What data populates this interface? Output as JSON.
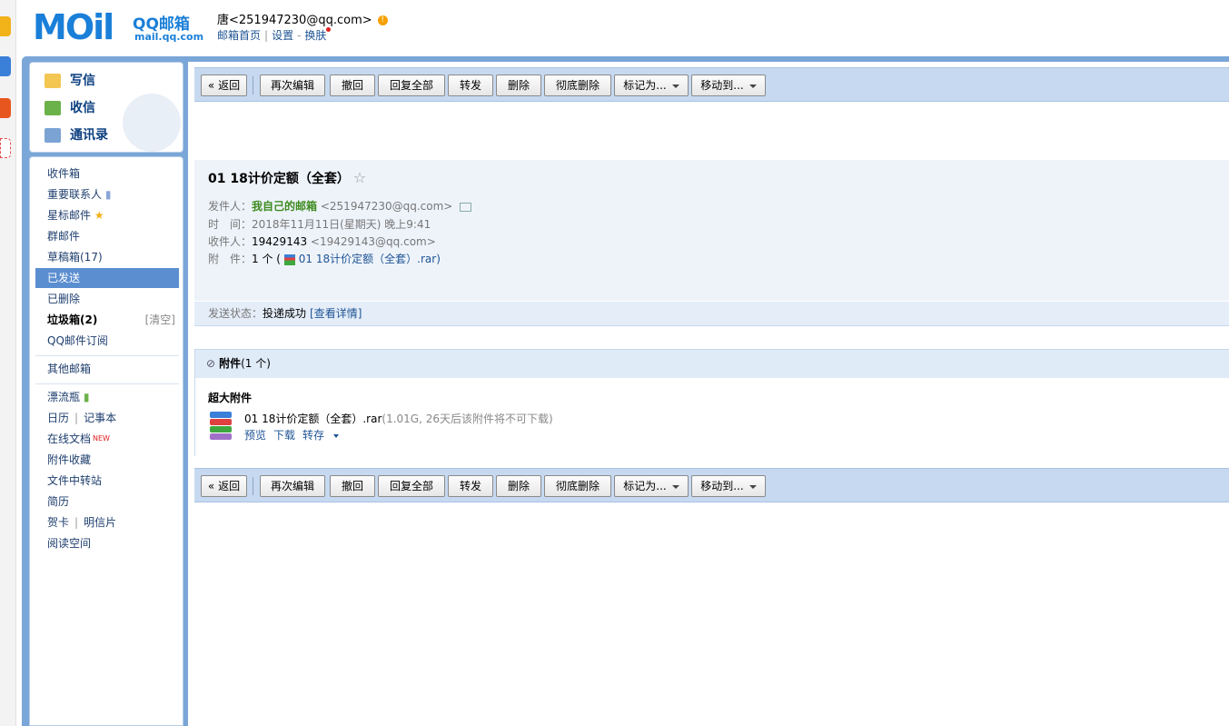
{
  "header": {
    "logo_word": "MOil",
    "logo_brand": "QQ邮箱",
    "logo_url": "mail.qq.com",
    "user": "唐<251947230@qq.com>",
    "links": [
      "邮箱首页",
      "设置",
      "换肤"
    ]
  },
  "compose": {
    "write": "写信",
    "receive": "收信",
    "contacts": "通讯录"
  },
  "folders": {
    "inbox": "收件箱",
    "important": "重要联系人",
    "starred": "星标邮件",
    "group": "群邮件",
    "drafts": "草稿箱(17)",
    "sent": "已发送",
    "deleted": "已删除",
    "junk": "垃圾箱(2)",
    "junk_clear": "[清空]",
    "subscriptions": "QQ邮件订阅",
    "other": "其他邮箱",
    "bottle": "漂流瓶",
    "calendar": "日历",
    "notes": "记事本",
    "docs": "在线文档",
    "docs_new": "NEW",
    "att_fav": "附件收藏",
    "transfer": "文件中转站",
    "resume": "简历",
    "greeting": "贺卡",
    "postcard": "明信片",
    "reading": "阅读空间"
  },
  "toolbar": {
    "back": "« 返回",
    "reedit": "再次编辑",
    "recall": "撤回",
    "reply_all": "回复全部",
    "forward": "转发",
    "delete": "删除",
    "perm_delete": "彻底删除",
    "mark_as": "标记为...",
    "move_to": "移动到..."
  },
  "mail": {
    "subject": "01 18计价定额（全套）",
    "star": "☆",
    "from_label": "发件人：",
    "from_name": "我自己的邮箱",
    "from_addr": "<251947230@qq.com>",
    "time_label": "时　间：",
    "time": "2018年11月11日(星期天) 晚上9:41",
    "to_label": "收件人：",
    "to_name": "19429143",
    "to_addr": "<19429143@qq.com>",
    "att_label": "附　件：",
    "att_count": "1 个 (",
    "att_file": "01 18计价定额（全套）.rar",
    "att_close": ")",
    "status_label": "发送状态：",
    "status": "投递成功",
    "status_link": "[查看详情]"
  },
  "attachments": {
    "title": "附件",
    "count": "(1 个)",
    "section": "超大附件",
    "file_name": "01 18计价定额（全套）.rar",
    "file_info": "(1.01G, 26天后该附件将不可下载)",
    "preview": "预览",
    "download": "下载",
    "save": "转存"
  },
  "colors": {
    "accent": "#5b8ed0",
    "frame": "#7aa6d8",
    "toolbar_bg": "#c6d9f0",
    "sender_green": "#3d8b1f"
  }
}
